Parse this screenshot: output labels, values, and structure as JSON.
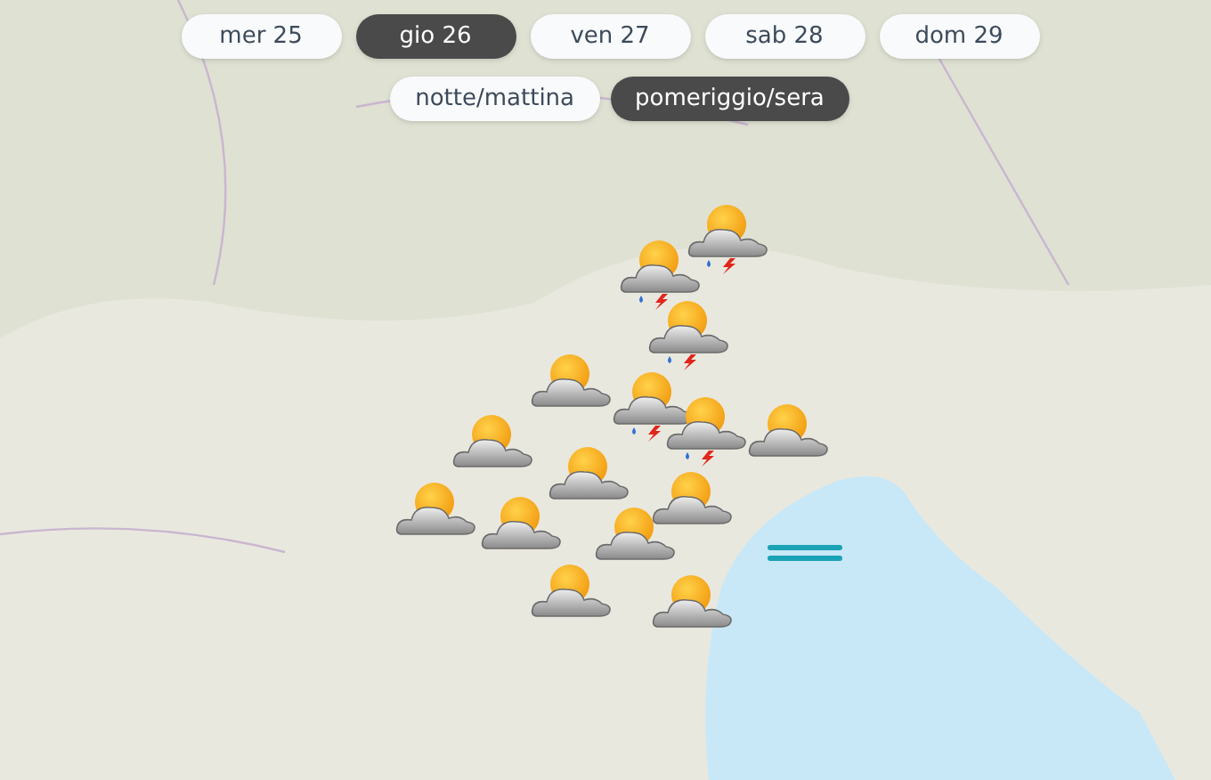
{
  "days": [
    {
      "label": "mer 25",
      "selected": false
    },
    {
      "label": "gio 26",
      "selected": true
    },
    {
      "label": "ven 27",
      "selected": false
    },
    {
      "label": "sab 28",
      "selected": false
    },
    {
      "label": "dom 29",
      "selected": false
    }
  ],
  "periods": [
    {
      "label": "notte/mattina",
      "selected": false
    },
    {
      "label": "pomeriggio/sera",
      "selected": true
    }
  ],
  "markers": [
    {
      "kind": "storm"
    },
    {
      "kind": "storm"
    },
    {
      "kind": "storm"
    },
    {
      "kind": "partly-cloudy"
    },
    {
      "kind": "storm"
    },
    {
      "kind": "partly-cloudy"
    },
    {
      "kind": "storm"
    },
    {
      "kind": "partly-cloudy"
    },
    {
      "kind": "partly-cloudy"
    },
    {
      "kind": "partly-cloudy"
    },
    {
      "kind": "partly-cloudy"
    },
    {
      "kind": "partly-cloudy"
    },
    {
      "kind": "partly-cloudy"
    },
    {
      "kind": "partly-cloudy"
    },
    {
      "kind": "partly-cloudy"
    },
    {
      "kind": "fog"
    }
  ]
}
